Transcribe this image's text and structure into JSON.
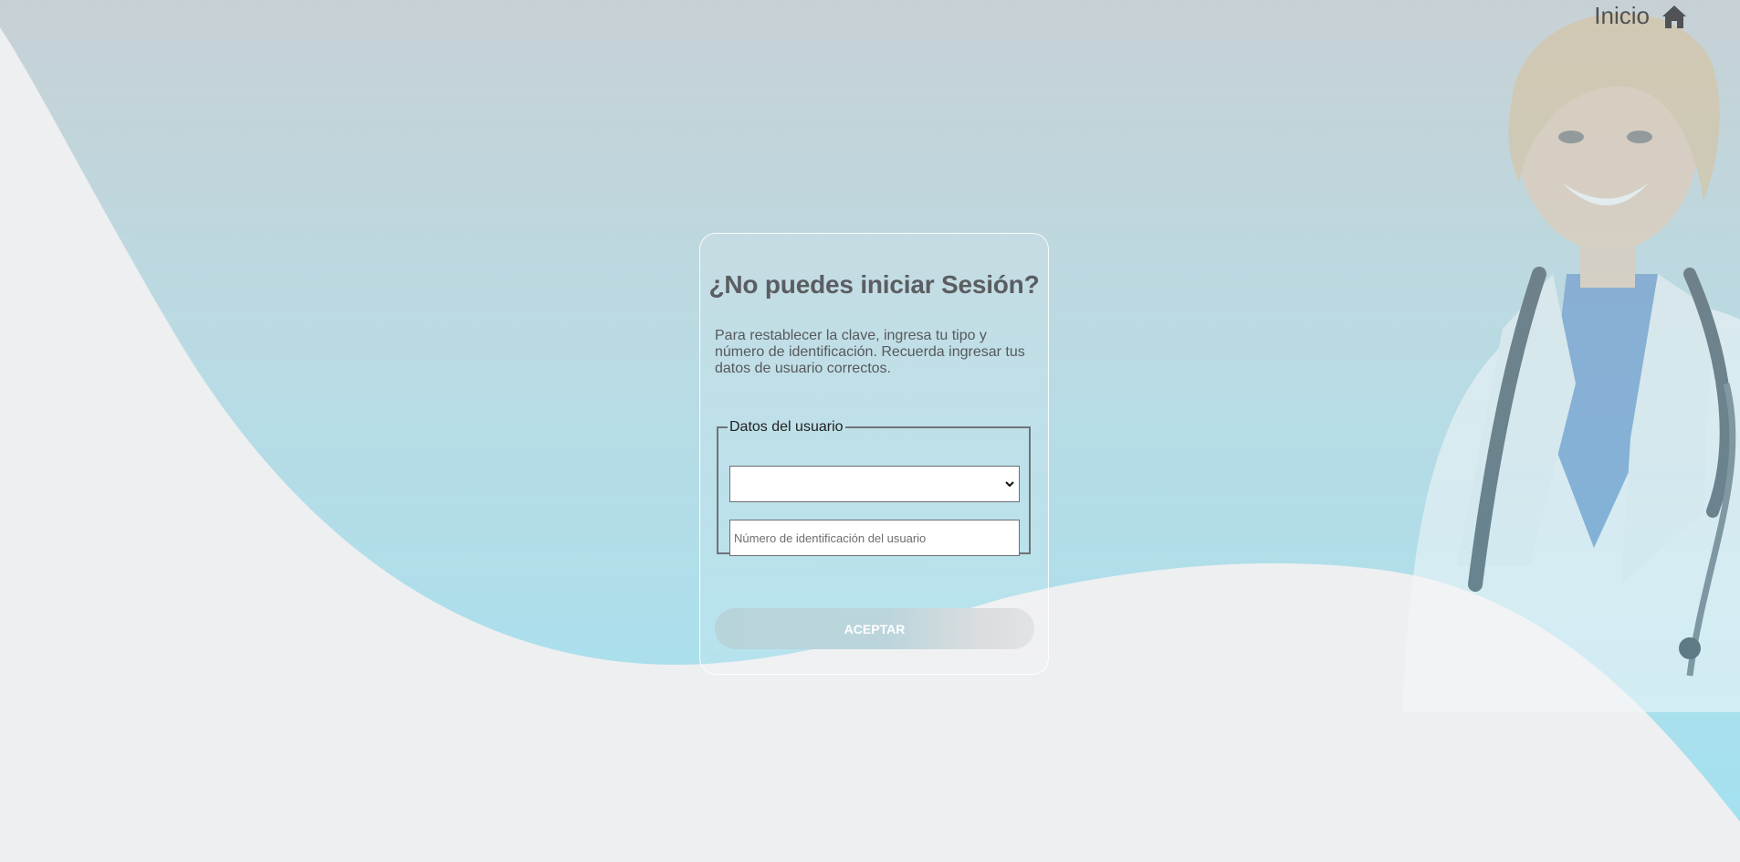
{
  "header": {
    "home_label": "Inicio",
    "home_icon": "home-icon"
  },
  "recover": {
    "title": "¿No puedes iniciar Sesión?",
    "description": "Para restablecer la clave, ingresa tu tipo y número de identificación. Recuerda ingresar tus datos de usuario correctos.",
    "fieldset_legend": "Datos del usuario",
    "id_type_value": "",
    "id_number_placeholder": "Número de identificación del usuario",
    "submit_label": "ACEPTAR"
  },
  "colors": {
    "page_background": "#eeeff1",
    "wave_top": "#c6d2d6",
    "wave_bottom": "#a5e0ef",
    "text_muted": "#5a5d61",
    "button_start": "#b8d4db",
    "button_end": "#e2e3e4"
  }
}
